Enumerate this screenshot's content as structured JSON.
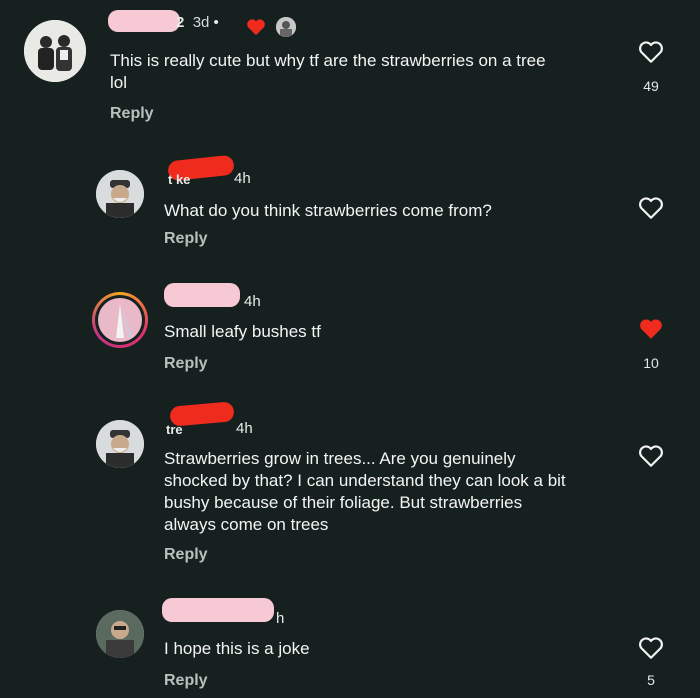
{
  "comments": [
    {
      "name_visible": "2",
      "time": "3d",
      "separator": "•",
      "text_lines": [
        "This is really cute but why tf are the strawberries on a tree",
        "lol"
      ],
      "reply_label": "Reply",
      "likes": "49",
      "liked": false
    },
    {
      "name_visible": "t  ke",
      "time": "4h",
      "text_lines": [
        "What do you think strawberries come from?"
      ],
      "reply_label": "Reply",
      "likes": "",
      "liked": false
    },
    {
      "name_visible": "",
      "time": "4h",
      "text_lines": [
        "Small leafy bushes tf"
      ],
      "reply_label": "Reply",
      "likes": "10",
      "liked": true
    },
    {
      "name_visible": "tre",
      "time": "4h",
      "text_lines": [
        "Strawberries grow in trees... Are you genuinely",
        "shocked by that? I can understand they can look a bit",
        "bushy because of their foliage. But strawberries",
        "always come on trees"
      ],
      "reply_label": "Reply",
      "likes": "",
      "liked": false
    },
    {
      "name_visible": "",
      "time": "h",
      "text_lines": [
        "I hope this is a joke"
      ],
      "reply_label": "Reply",
      "likes": "5",
      "liked": false
    }
  ],
  "icons": {
    "like": "heart-icon",
    "liked": "heart-filled-icon",
    "creator_like": "creator-like-icon"
  },
  "colors": {
    "background": "#16201f",
    "liked_heart": "#ee2b1c",
    "redaction_pink": "#f7c9d4",
    "redaction_red": "#ee2b1c"
  }
}
